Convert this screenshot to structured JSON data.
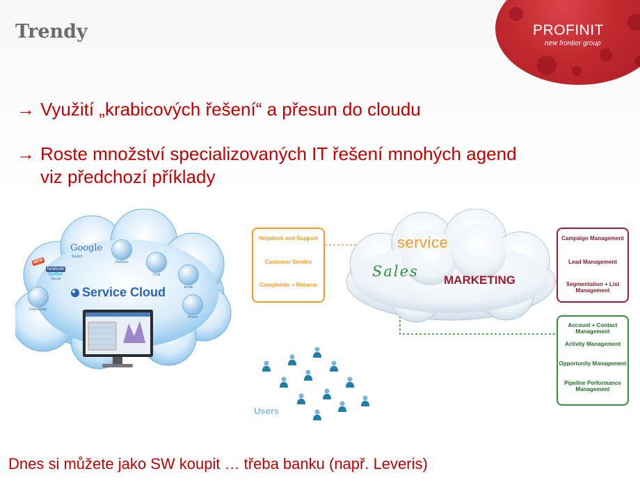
{
  "slide": {
    "title": "Trendy",
    "bullets": [
      {
        "arrow": "→",
        "line1": "Využití „krabicových řešení“ a přesun do cloudu",
        "line2": ""
      },
      {
        "arrow": "→",
        "line1": "Roste množství specializovaných IT řešení mnohých agend",
        "line2": "viz předchozí příklady"
      }
    ],
    "footer": "Dnes si můžete jako SW koupit … třeba banku (např. Leveris)"
  },
  "logo": {
    "name": "PROFINIT",
    "tagline": "new frontier group",
    "color": "#c0282f"
  },
  "service_cloud": {
    "title": "Service Cloud",
    "google": "Google",
    "new_badge": "NEW",
    "items": [
      {
        "label": "Search",
        "icon": "google-icon"
      },
      {
        "label": "Partners",
        "icon": "handshake-icon"
      },
      {
        "label": "Chat",
        "icon": "chat-icon"
      },
      {
        "label": "Email",
        "icon": "email-icon"
      },
      {
        "label": "Phone",
        "icon": "phone-icon"
      },
      {
        "label": "Community",
        "icon": "community-icon"
      },
      {
        "label": "Social",
        "icon": "social-icon"
      }
    ],
    "social_words": [
      "facebook",
      "twitter"
    ]
  },
  "crm_diagram": {
    "service_box": [
      "Helpdesk and Support",
      "Customer Service",
      "Complaints + Returns"
    ],
    "cloud_words": {
      "service": "service",
      "sales": "Sales",
      "marketing": "MARKETING"
    },
    "marketing_box": [
      "Campaign Management",
      "Lead Management",
      "Segmentation + List Management"
    ],
    "sales_box": [
      "Account + Contact Management",
      "Activity Management",
      "Opportunity Management",
      "Pipeline Performance Management"
    ],
    "users_label": "Users",
    "colors": {
      "service": "#f39a1e",
      "sales": "#2f8f3a",
      "marketing": "#9b1b2e",
      "users": "#8bb8da"
    }
  }
}
